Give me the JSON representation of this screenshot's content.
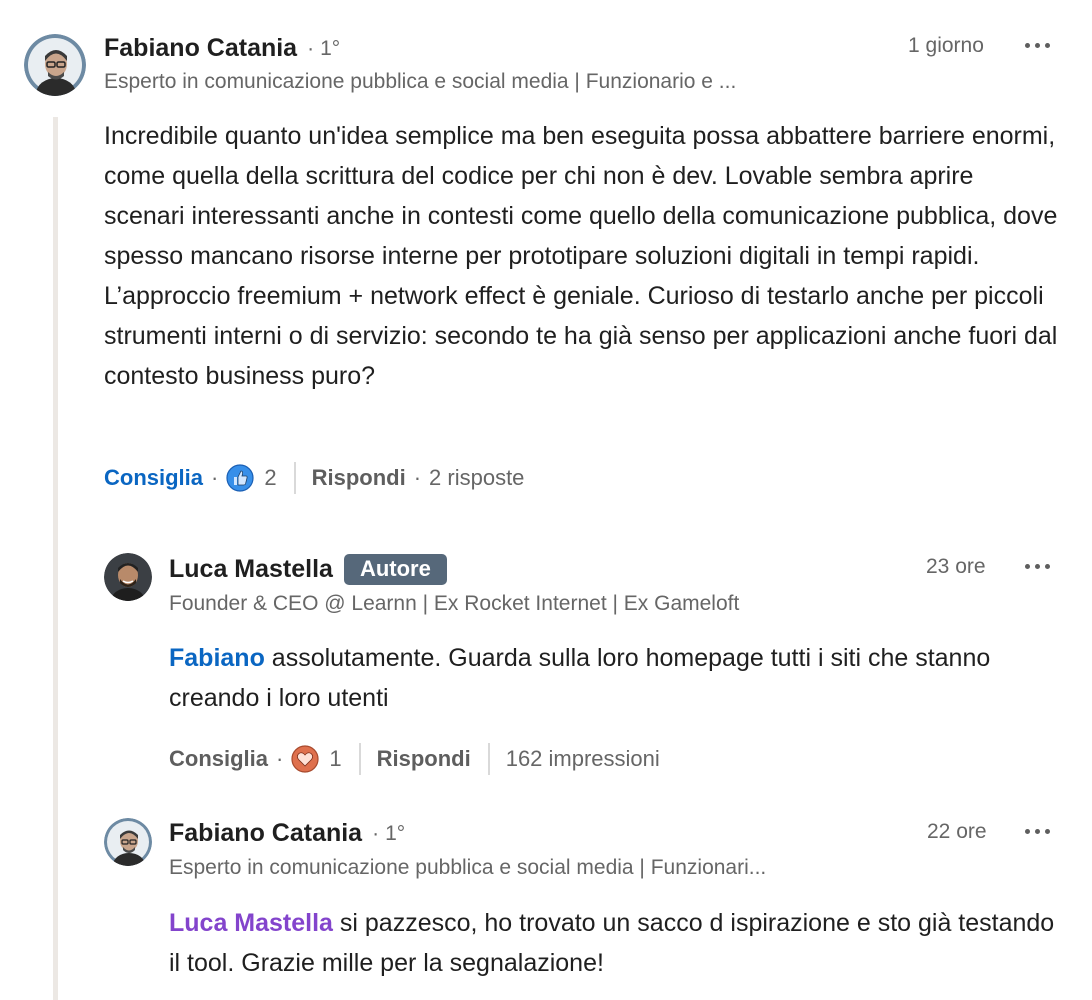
{
  "comments": [
    {
      "author": "Fabiano Catania",
      "degree": "1°",
      "headline": "Esperto in comunicazione pubblica e social media | Funzionario e ...",
      "time": "1 giorno",
      "text": "Incredibile quanto un'idea semplice ma ben eseguita possa abbattere barriere enormi, come quella della scrittura del codice per chi non è dev. Lovable sembra aprire scenari interessanti anche in contesti come quello della comunicazione pubblica, dove spesso mancano risorse interne per prototipare soluzioni digitali in tempi rapidi. L’approccio freemium + network effect è geniale. Curioso di testarlo anche per piccoli strumenti interni o di servizio: secondo te ha già senso per applicazioni anche fuori dal contesto business puro?",
      "like_label": "Consiglia",
      "reaction_icon": "like-icon",
      "reaction_count": "2",
      "reply_label": "Rispondi",
      "replies_text": "2 risposte"
    },
    {
      "author": "Luca Mastella",
      "badge": "Autore",
      "headline": "Founder & CEO @ Learnn | Ex Rocket Internet | Ex Gameloft",
      "time": "23 ore",
      "mention": "Fabiano",
      "text": " assolutamente. Guarda sulla loro homepage tutti i siti che stanno creando i loro utenti",
      "like_label": "Consiglia",
      "reaction_icon": "love-icon",
      "reaction_count": "1",
      "reply_label": "Rispondi",
      "impressions": "162 impressioni"
    },
    {
      "author": "Fabiano Catania",
      "degree": "1°",
      "headline": "Esperto in comunicazione pubblica e social media | Funzionari...",
      "time": "22 ore",
      "mention": "Luca Mastella",
      "text": " si pazzesco, ho trovato un sacco d ispirazione e sto già testando il tool. Grazie mille per la segnalazione!"
    }
  ],
  "colors": {
    "link_blue": "#0a66c2",
    "mention_purple": "#8344cc",
    "badge_bg": "#56687a",
    "thread_line": "#ece8e4",
    "like_blue": "#378fe9",
    "love_orange": "#df704d"
  }
}
